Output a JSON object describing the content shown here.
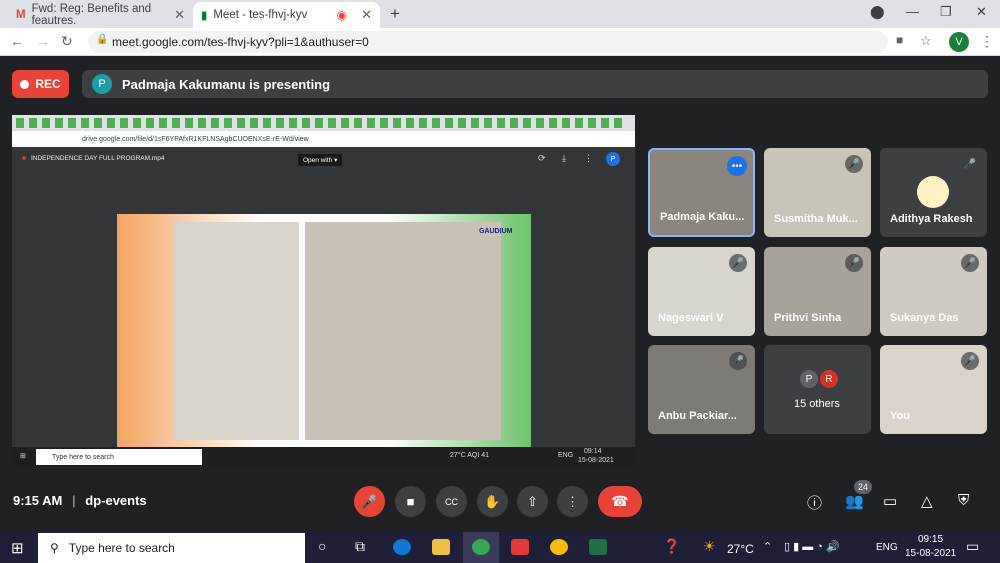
{
  "browser": {
    "tabs": [
      {
        "label": "Fwd: Reg: Benefits and feautres."
      },
      {
        "label": "Meet - tes-fhvj-kyv"
      }
    ],
    "url": "meet.google.com/tes-fhvj-kyv?pli=1&authuser=0",
    "profile": "V"
  },
  "meet": {
    "rec_label": "REC",
    "presenter_avatar": "P",
    "presenter_text": "Padmaja Kakumanu is presenting",
    "shared": {
      "url": "drive.google.com/file/d/1sF6YPAfxR1KFLNSAgbCUOENXsE-rE-Wd/view",
      "file": "INDEPENDENCE DAY FULL PROGRAM.mp4",
      "open_with": "Open with",
      "logo": "GAUDIUM",
      "search": "Type here to search",
      "weather": "27°C  AQI 41",
      "lang": "ENG",
      "time": "09:14",
      "date": "15-08-2021"
    },
    "participants": [
      {
        "name": "Padmaja Kaku...",
        "bg": "#8a857d"
      },
      {
        "name": "Susmitha Muk...",
        "bg": "#c9c4b8"
      },
      {
        "name": "Adithya Rakesh",
        "bg": "#3c4043"
      },
      {
        "name": "Nageswari V",
        "bg": "#d8d5cf"
      },
      {
        "name": "Prithvi Sinha",
        "bg": "#a7a29a"
      },
      {
        "name": "Sukanya Das",
        "bg": "#cfcac4"
      },
      {
        "name": "Anbu Packiar...",
        "bg": "#7e7a75"
      },
      {
        "name": "15 others",
        "bg": "#3c4043"
      },
      {
        "name": "You",
        "bg": "#d9d3ca"
      }
    ],
    "others_avatars": [
      "P",
      "R"
    ],
    "time": "9:15 AM",
    "meeting_code": "dp-events",
    "people_count": "24"
  },
  "taskbar": {
    "search": "Type here to search",
    "temp": "27°C",
    "lang": "ENG",
    "time": "09:15",
    "date": "15-08-2021"
  }
}
